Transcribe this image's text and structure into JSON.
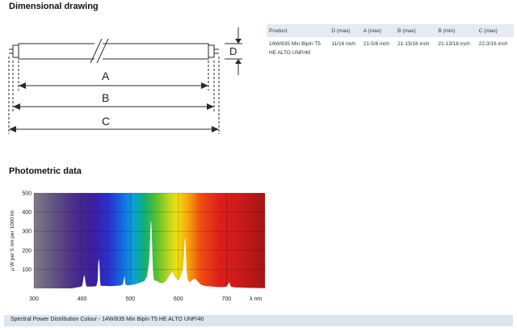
{
  "dimensional": {
    "title": "Dimensional drawing",
    "labels": {
      "a": "A",
      "b": "B",
      "c": "C",
      "d": "D"
    },
    "table": {
      "headers": [
        "Product",
        "D (max)",
        "A (max)",
        "B (max)",
        "B (min)",
        "C (max)"
      ],
      "rows": [
        [
          "14W/835 Min Bipin T5",
          "11/16 inch",
          "21-5/8 inch",
          "21-15/16 inch",
          "21-13/16 inch",
          "22-3/16 inch"
        ]
      ],
      "row_continuation": "HE ALTO UNP/40"
    }
  },
  "photometric": {
    "title": "Photometric data",
    "caption": "Spectral Power Distribution Colour - 14W/835 Min Bipin T5 HE ALTO UNP/40"
  },
  "chart_data": {
    "type": "area",
    "ylabel": "µ W per 5 nm per 1000 lm",
    "xlabel": "λ nm",
    "xlim": [
      300,
      780
    ],
    "ylim": [
      0,
      500
    ],
    "x_ticks": [
      300,
      400,
      500,
      600,
      700
    ],
    "y_ticks": [
      100,
      200,
      300,
      400,
      500
    ],
    "background": "visible spectrum gradient",
    "grid": true,
    "series": [
      {
        "color": "#ffffff",
        "x": [
          380,
          385,
          390,
          395,
          400,
          402,
          404,
          405,
          406,
          408,
          410,
          420,
          430,
          433,
          434,
          435,
          436,
          437,
          438,
          440,
          450,
          460,
          470,
          480,
          485,
          487,
          488,
          489,
          490,
          495,
          500,
          510,
          520,
          530,
          535,
          540,
          542,
          543,
          544,
          545,
          546,
          547,
          548,
          550,
          555,
          560,
          565,
          570,
          575,
          580,
          585,
          588,
          590,
          595,
          600,
          605,
          610,
          612,
          613,
          614,
          615,
          616,
          617,
          618,
          620,
          625,
          630,
          635,
          640,
          645,
          650,
          660,
          670,
          680,
          690,
          700,
          705,
          706,
          707,
          710,
          720,
          730,
          740,
          760,
          780
        ],
        "y": [
          0,
          2,
          4,
          6,
          10,
          30,
          62,
          64,
          40,
          15,
          8,
          8,
          10,
          40,
          120,
          150,
          110,
          40,
          15,
          12,
          12,
          10,
          12,
          14,
          20,
          40,
          60,
          35,
          18,
          15,
          16,
          20,
          28,
          38,
          60,
          140,
          260,
          350,
          310,
          230,
          150,
          90,
          55,
          40,
          38,
          30,
          25,
          28,
          40,
          60,
          75,
          85,
          70,
          50,
          40,
          60,
          100,
          160,
          230,
          260,
          200,
          130,
          80,
          60,
          40,
          30,
          45,
          50,
          35,
          22,
          15,
          10,
          8,
          6,
          5,
          7,
          25,
          30,
          18,
          6,
          4,
          3,
          2,
          1,
          0
        ]
      }
    ]
  }
}
